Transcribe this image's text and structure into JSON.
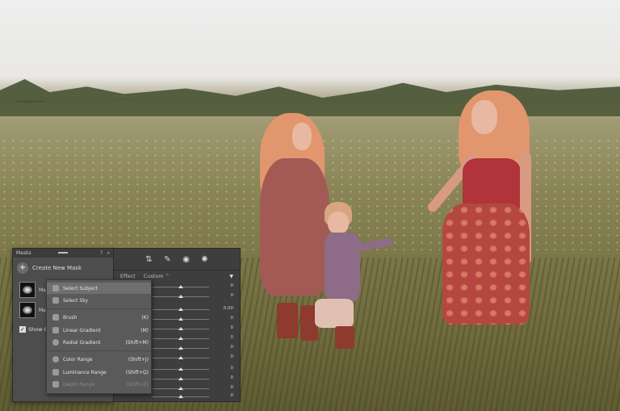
{
  "masks_panel": {
    "title": "Masks",
    "header_icons": [
      "help-icon",
      "more-icon"
    ],
    "create_label": "Create New Mask",
    "masks": [
      {
        "label": "Ma"
      },
      {
        "label": "Ma"
      }
    ],
    "show_overlay_label": "Show O"
  },
  "adjust_panel": {
    "tools": [
      "brush-tool-icon",
      "eraser-icon",
      "eye-icon",
      "mask-icon"
    ],
    "effect_label": "Effect",
    "effect_value": "Custom",
    "slider_values": [
      "0",
      "0",
      "0.00",
      "0",
      "0",
      "0",
      "0",
      "0",
      "0",
      "0",
      "0",
      "0"
    ]
  },
  "menu": {
    "items": [
      {
        "label": "Select Subject",
        "shortcut": "",
        "disabled": false,
        "highlight": true
      },
      {
        "label": "Select Sky",
        "shortcut": "",
        "disabled": false,
        "highlight": false
      },
      {
        "label": "Brush",
        "shortcut": "(K)",
        "disabled": false,
        "highlight": false
      },
      {
        "label": "Linear Gradient",
        "shortcut": "(M)",
        "disabled": false,
        "highlight": false
      },
      {
        "label": "Radial Gradient",
        "shortcut": "(Shift+M)",
        "disabled": false,
        "highlight": false
      },
      {
        "label": "Color Range",
        "shortcut": "(Shift+J)",
        "disabled": false,
        "highlight": false
      },
      {
        "label": "Luminance Range",
        "shortcut": "(Shift+Q)",
        "disabled": false,
        "highlight": false
      },
      {
        "label": "Depth Range",
        "shortcut": "(Shift+Z)",
        "disabled": true,
        "highlight": false
      }
    ]
  }
}
